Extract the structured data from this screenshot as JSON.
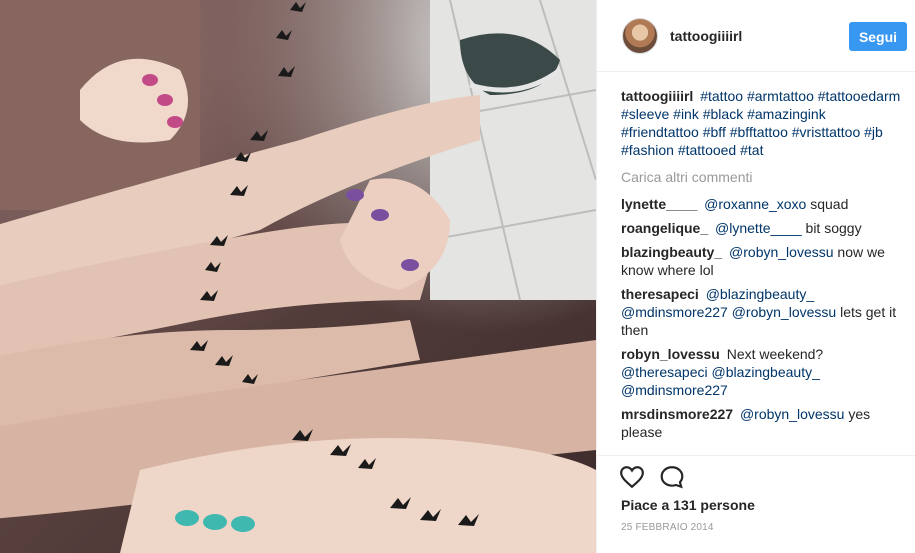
{
  "post": {
    "image_alt": "Friends arm tattoo of flying birds",
    "colors": {
      "accent": "#3897f0",
      "hashtag": "#003569",
      "muted": "#999999"
    }
  },
  "header": {
    "username": "tattoogiiiirl",
    "follow_label": "Segui"
  },
  "caption": {
    "username": "tattoogiiiirl",
    "hashtags": [
      "#tattoo",
      "#armtattoo",
      "#tattooedarm",
      "#sleeve",
      "#ink",
      "#black",
      "#amazingink",
      "#friendtattoo",
      "#bff",
      "#bfftattoo",
      "#vristtattoo",
      "#jb",
      "#fashion",
      "#tattooed",
      "#tat"
    ]
  },
  "load_more_label": "Carica altri commenti",
  "comments": [
    {
      "user": "lynette____",
      "mentions": [
        "@roxanne_xoxo"
      ],
      "text": "squad"
    },
    {
      "user": "roangelique_",
      "mentions": [
        "@lynette____"
      ],
      "text": "bit soggy"
    },
    {
      "user": "blazingbeauty_",
      "mentions": [
        "@robyn_lovessu"
      ],
      "text": "now we know where lol"
    },
    {
      "user": "theresapeci",
      "mentions": [
        "@blazingbeauty_",
        "@mdinsmore227",
        "@robyn_lovessu"
      ],
      "text": "lets get it then"
    },
    {
      "user": "robyn_lovessu",
      "mentions": [],
      "text": "Next weekend?",
      "trailing_mentions": [
        "@theresapeci",
        "@blazingbeauty_",
        "@mdinsmore227"
      ]
    },
    {
      "user": "mrsdinsmore227",
      "mentions": [
        "@robyn_lovessu"
      ],
      "text": "yes please"
    }
  ],
  "actions": {
    "like_icon": "heart-icon",
    "comment_icon": "speech-bubble-icon"
  },
  "likes_text": "Piace a 131 persone",
  "date_text": "25 FEBBRAIO 2014"
}
